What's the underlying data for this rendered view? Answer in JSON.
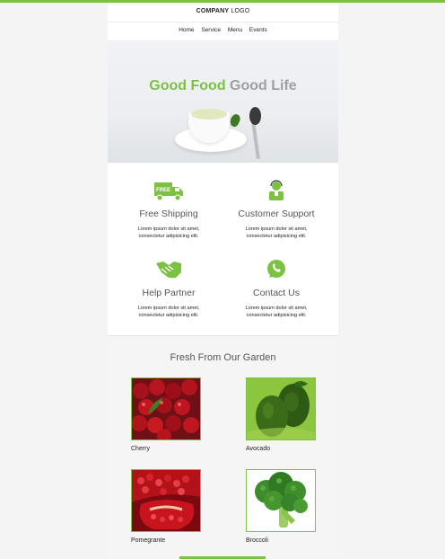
{
  "brand": {
    "accent": "#7cc242",
    "logo_bold": "COMPANY",
    "logo_light": "LOGO"
  },
  "nav": {
    "items": [
      "Home",
      "Service",
      "Menu",
      "Events"
    ]
  },
  "hero": {
    "title_green": "Good Food",
    "title_gray": "Good Life"
  },
  "features": [
    {
      "icon": "free-truck-icon",
      "title": "Free Shipping",
      "body_line1": "Lorem ipsum dolor sit amet,",
      "body_line2": "consectetur adipisicing elit."
    },
    {
      "icon": "support-agent-icon",
      "title": "Customer Support",
      "body_line1": "Lorem ipsum dolor sit amet,",
      "body_line2": "consectetur adipisicing elit."
    },
    {
      "icon": "handshake-icon",
      "title": "Help Partner",
      "body_line1": "Lorem ipsum dolor sit amet,",
      "body_line2": "consectetur adipisicing elit."
    },
    {
      "icon": "whatsapp-icon",
      "title": "Contact Us",
      "body_line1": "Lorem ipsum dolor sit amet,",
      "body_line2": "consectetur adipisicing elit."
    }
  ],
  "garden": {
    "title": "Fresh From Our Garden",
    "products": [
      {
        "name": "Cherry",
        "image": "cherry-image"
      },
      {
        "name": "Avocado",
        "image": "avocado-image"
      },
      {
        "name": "Pomegrante",
        "image": "pomegranate-image"
      },
      {
        "name": "Broccoli",
        "image": "broccoli-image"
      }
    ]
  }
}
